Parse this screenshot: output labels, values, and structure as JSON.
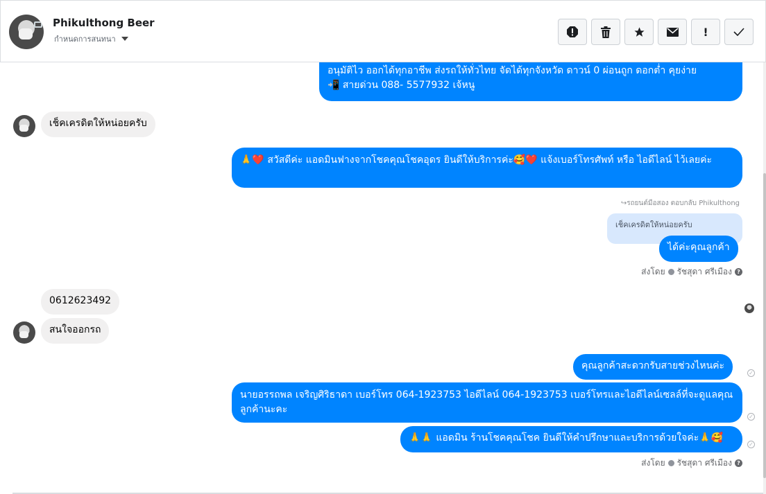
{
  "header": {
    "name": "Phikulthong Beer",
    "subtitle": "กำหนดการสนทนา",
    "toolbar_icons": [
      "spam-icon",
      "trash-icon",
      "star-icon",
      "envelope-icon",
      "exclamation-icon",
      "checkmark-icon"
    ]
  },
  "messages": {
    "m1_line1": "อนุมัติไว ออกได้ทุกอาชีพ ส่งรถให้ทั่วไทย จัดได้ทุกจังหวัด ดาวน์ 0  ผ่อนถูก ดอกต่ำ คุยง่าย",
    "m1_line2": "📲 สายด่วน 088- 5577932 เจ้หนู",
    "m2": "เช็คเครดิตให้หน่อยครับ",
    "m3": "🙏❤️ สวัสดีค่ะ แอดมินฟางจากโชคคุณโชคอุดร ยินดีให้บริการค่ะ🥰❤️ แจ้งเบอร์โทรศัพท์ หรือ ไอดีไลน์  ไว้เลยค่ะ",
    "reply_note": "รถยนต์มือสอง ตอบกลับ Phikulthong",
    "quoted": "เช็คเครดิตให้หน่อยครับ",
    "m4": "ได้ค่ะคุณลูกค้า",
    "sent_by_1": "ส่งโดย",
    "agent_1": "รัชสุดา ศรีเมือง",
    "m5": "0612623492",
    "m6": "สนใจออกรถ",
    "m7": "คุณลูกค้าสะดวกรับสายช่วงไหนค่ะ",
    "m8": "นายอรรถพล เจริญศิริธาดา     เบอร์โทร 064-1923753 ไอดีไลน์ 064-1923753  เบอร์โทรและไอดีไลน์เซลล์ที่จะดูแลคุณลูกค้านะคะ",
    "m9": "🙏🙏 แอดมิน ร้านโชคคุณโชค ยินดีให้คำปรึกษาและบริการด้วยใจค่ะ🙏🥰",
    "sent_by_2": "ส่งโดย",
    "agent_2": "รัชสุดา ศรีเมือง"
  },
  "colors": {
    "outgoing": "#0084ff",
    "incoming": "#f1f0f0",
    "quoted": "#d8e8fd"
  }
}
